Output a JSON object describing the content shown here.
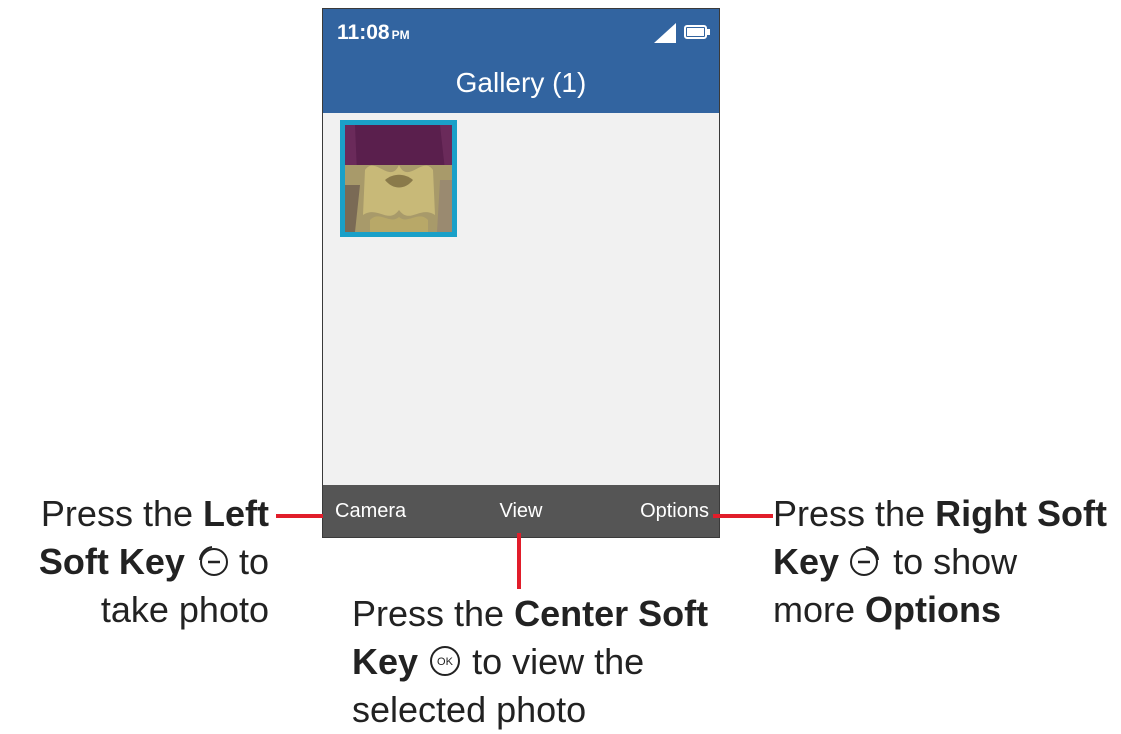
{
  "status": {
    "time": "11:08",
    "ampm": "PM"
  },
  "app": {
    "title": "Gallery (1)"
  },
  "softkeys": {
    "left": "Camera",
    "center": "View",
    "right": "Options"
  },
  "callouts": {
    "left": {
      "pre": "Press the ",
      "bold1": "Left",
      "bold2": "Soft Key",
      "post": " to",
      "line3": "take photo"
    },
    "center": {
      "pre": "Press the ",
      "bold1": "Center Soft",
      "bold2": "Key",
      "post": " to view the",
      "line3": "selected photo"
    },
    "right": {
      "pre": "Press the ",
      "bold1": "Right Soft",
      "bold2": "Key",
      "post": " to show",
      "line3pre": "more ",
      "line3bold": "Options"
    }
  },
  "colors": {
    "header": "#3264a0",
    "softbar": "#555555",
    "accent": "#e11d2a",
    "thumb_border": "#1aa0c8"
  }
}
